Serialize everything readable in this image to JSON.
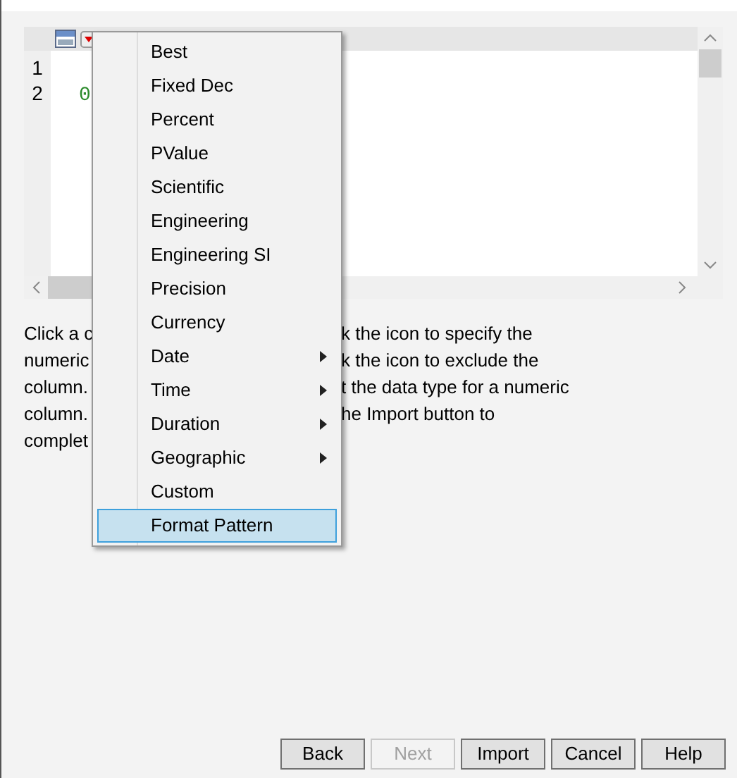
{
  "data_preview": {
    "row_numbers": [
      "1",
      "2"
    ],
    "cell": "0"
  },
  "format_menu": {
    "items": [
      {
        "label": "Best",
        "submenu": false,
        "selected": false
      },
      {
        "label": "Fixed Dec",
        "submenu": false,
        "selected": false
      },
      {
        "label": "Percent",
        "submenu": false,
        "selected": false
      },
      {
        "label": "PValue",
        "submenu": false,
        "selected": false
      },
      {
        "label": "Scientific",
        "submenu": false,
        "selected": false
      },
      {
        "label": "Engineering",
        "submenu": false,
        "selected": false
      },
      {
        "label": "Engineering SI",
        "submenu": false,
        "selected": false
      },
      {
        "label": "Precision",
        "submenu": false,
        "selected": false
      },
      {
        "label": "Currency",
        "submenu": false,
        "selected": false
      },
      {
        "label": "Date",
        "submenu": true,
        "selected": false
      },
      {
        "label": "Time",
        "submenu": true,
        "selected": false
      },
      {
        "label": "Duration",
        "submenu": true,
        "selected": false
      },
      {
        "label": "Geographic",
        "submenu": true,
        "selected": false
      },
      {
        "label": "Custom",
        "submenu": false,
        "selected": false
      },
      {
        "label": "Format Pattern",
        "submenu": false,
        "selected": true
      }
    ]
  },
  "instructions": [
    {
      "left": "Click a c",
      "right": "k the icon to specify the"
    },
    {
      "left": "numeric",
      "right": "k the icon to exclude the"
    },
    {
      "left": "column.",
      "right": "t the data type for a numeric"
    },
    {
      "left": "column.",
      "right": "he Import button to"
    },
    {
      "left": "complet"
    }
  ],
  "buttons": [
    {
      "label": "Back",
      "disabled": false
    },
    {
      "label": "Next",
      "disabled": true
    },
    {
      "label": "Import",
      "disabled": false
    },
    {
      "label": "Cancel",
      "disabled": false
    },
    {
      "label": "Help",
      "disabled": false
    }
  ]
}
